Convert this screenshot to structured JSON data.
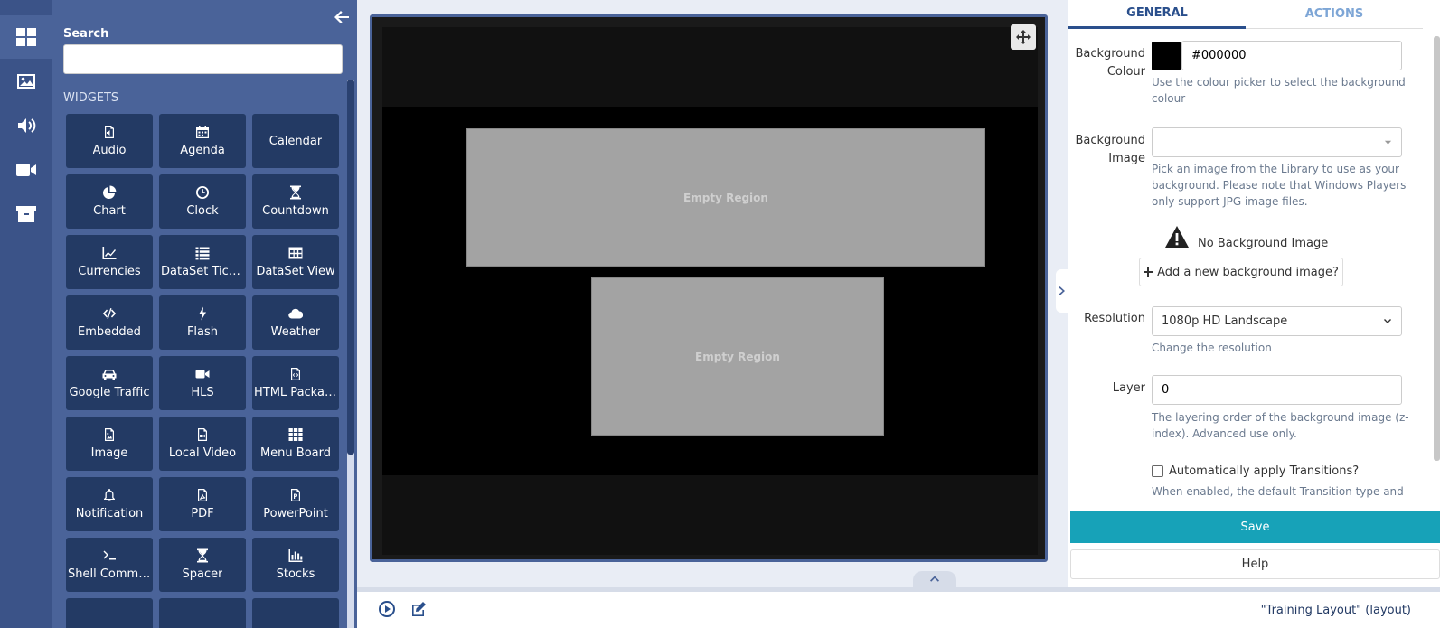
{
  "rail": {
    "items": [
      {
        "name": "widgets",
        "icon": "dashboard-icon"
      },
      {
        "name": "library",
        "icon": "image-icon"
      },
      {
        "name": "audio",
        "icon": "volume-icon"
      },
      {
        "name": "video",
        "icon": "video-camera-icon"
      },
      {
        "name": "archive",
        "icon": "archive-icon"
      }
    ]
  },
  "toolbox": {
    "search_label": "Search",
    "search_value": "",
    "widgets_title": "WIDGETS",
    "widgets": [
      {
        "label": "Audio",
        "icon": "audio-file-icon"
      },
      {
        "label": "Agenda",
        "icon": "calendar-icon"
      },
      {
        "label": "Calendar",
        "icon": ""
      },
      {
        "label": "Chart",
        "icon": "pie-chart-icon"
      },
      {
        "label": "Clock",
        "icon": "clock-icon"
      },
      {
        "label": "Countdown",
        "icon": "hourglass-icon"
      },
      {
        "label": "Currencies",
        "icon": "line-chart-icon"
      },
      {
        "label": "DataSet Ticker",
        "icon": "list-icon"
      },
      {
        "label": "DataSet View",
        "icon": "table-icon"
      },
      {
        "label": "Embedded",
        "icon": "code-icon"
      },
      {
        "label": "Flash",
        "icon": "bolt-icon"
      },
      {
        "label": "Weather",
        "icon": "cloud-icon"
      },
      {
        "label": "Google Traffic",
        "icon": "car-icon"
      },
      {
        "label": "HLS",
        "icon": "video-camera-icon"
      },
      {
        "label": "HTML Package",
        "icon": "code-file-icon"
      },
      {
        "label": "Image",
        "icon": "image-file-icon"
      },
      {
        "label": "Local Video",
        "icon": "video-file-icon"
      },
      {
        "label": "Menu Board",
        "icon": "grid-icon"
      },
      {
        "label": "Notification",
        "icon": "bell-icon"
      },
      {
        "label": "PDF",
        "icon": "pdf-file-icon"
      },
      {
        "label": "PowerPoint",
        "icon": "powerpoint-file-icon"
      },
      {
        "label": "Shell Comma...",
        "icon": "terminal-icon"
      },
      {
        "label": "Spacer",
        "icon": "hourglass-icon"
      },
      {
        "label": "Stocks",
        "icon": "bar-chart-icon"
      }
    ]
  },
  "viewer": {
    "regions": [
      {
        "label": "Empty Region"
      },
      {
        "label": "Empty Region"
      }
    ]
  },
  "bottom": {
    "layout_name": "\"Training Layout\" (layout)"
  },
  "props": {
    "tabs": {
      "general": "GENERAL",
      "actions": "ACTIONS"
    },
    "bg_colour_label_1": "Background",
    "bg_colour_label_2": "Colour",
    "bg_colour_value": "#000000",
    "bg_colour_swatch": "#000000",
    "bg_colour_help": "Use the colour picker to select the background colour",
    "bg_image_label_1": "Background",
    "bg_image_label_2": "Image",
    "bg_image_value": "",
    "bg_image_help": "Pick an image from the Library to use as your background. Please note that Windows Players only support JPG image files.",
    "no_bg_text": "No Background Image",
    "add_bg_text": "Add a new background image?",
    "resolution_label": "Resolution",
    "resolution_value": "1080p HD Landscape",
    "resolution_help": "Change the resolution",
    "layer_label": "Layer",
    "layer_value": "0",
    "layer_help": "The layering order of the background image (z-index). Advanced use only.",
    "auto_trans_label": "Automatically apply Transitions?",
    "auto_trans_checked": false,
    "auto_trans_help": "When enabled, the default Transition type and",
    "save_label": "Save",
    "help_label": "Help"
  },
  "colors": {
    "rail": "#3b5388",
    "toolbox": "#4a6399",
    "widget_tile": "#233a64",
    "save": "#17a2b8",
    "tab_active": "#2a4f8c",
    "tab_inactive": "#7ea6d6"
  }
}
